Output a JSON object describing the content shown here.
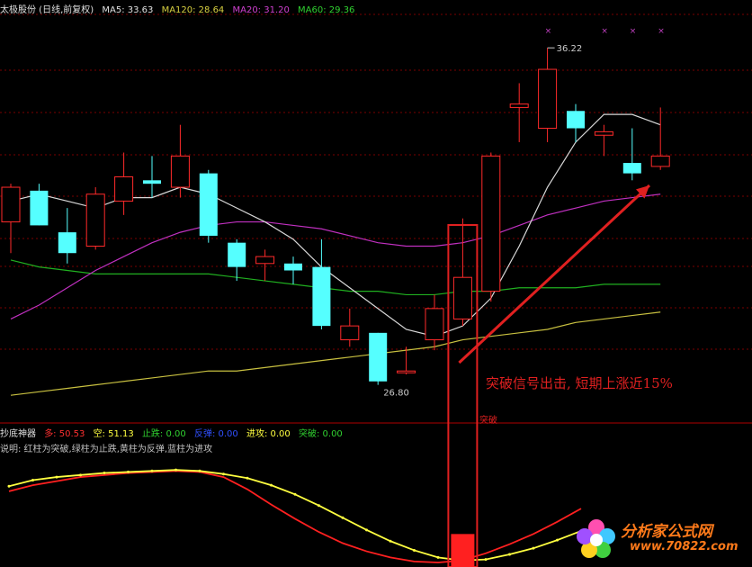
{
  "header": {
    "title": "太极股份 (日线,前复权)",
    "ma5_label": "MA5: 33.63",
    "ma120_label": "MA120: 28.64",
    "ma20_label": "MA20: 31.20",
    "ma60_label": "MA60: 29.36"
  },
  "colors": {
    "up": "#ff2a2a",
    "down": "#55ffff",
    "ma5": "#d8d8d8",
    "ma20": "#c030c0",
    "ma60": "#20b020",
    "ma120": "#c8c040",
    "grid": "#7a0000",
    "annotation": "#e02020",
    "sub_yellow": "#ffff40",
    "sub_red": "#ff2020"
  },
  "indicator": {
    "name": "抄底神器",
    "duo": "多: 50.53",
    "kong": "空: 51.13",
    "zhidie": "止跌: 0.00",
    "fantan": "反弹: 0.00",
    "jingong": "进攻: 0.00",
    "tupo": "突破: 0.00",
    "note": "说明: 红柱为突破,绿柱为止跌,黄柱为反弹,蓝柱为进攻"
  },
  "annotation": {
    "text": "突破信号出击, 短期上涨近15%",
    "signal_label": "突破"
  },
  "watermark": {
    "name": "分析家公式网",
    "url": "www.70822.com"
  },
  "chart_data": {
    "type": "candlestick",
    "price_range": [
      25.4,
      37.6
    ],
    "high_label": "36.22",
    "low_label": "26.80",
    "candles": [
      {
        "o": 31.2,
        "h": 32.3,
        "l": 30.3,
        "c": 32.2
      },
      {
        "o": 32.1,
        "h": 32.3,
        "l": 31.1,
        "c": 31.1
      },
      {
        "o": 30.9,
        "h": 31.6,
        "l": 30.0,
        "c": 30.3
      },
      {
        "o": 30.5,
        "h": 32.2,
        "l": 30.4,
        "c": 32.0
      },
      {
        "o": 31.8,
        "h": 33.2,
        "l": 31.4,
        "c": 32.5
      },
      {
        "o": 32.4,
        "h": 33.1,
        "l": 31.9,
        "c": 32.3
      },
      {
        "o": 32.2,
        "h": 34.0,
        "l": 31.9,
        "c": 33.1
      },
      {
        "o": 32.6,
        "h": 32.7,
        "l": 30.6,
        "c": 30.8
      },
      {
        "o": 30.6,
        "h": 30.7,
        "l": 29.5,
        "c": 29.9
      },
      {
        "o": 30.0,
        "h": 30.4,
        "l": 29.5,
        "c": 30.2
      },
      {
        "o": 30.0,
        "h": 30.2,
        "l": 29.4,
        "c": 29.8
      },
      {
        "o": 29.9,
        "h": 30.7,
        "l": 28.1,
        "c": 28.2
      },
      {
        "o": 27.8,
        "h": 28.7,
        "l": 27.6,
        "c": 28.2
      },
      {
        "o": 28.0,
        "h": 28.0,
        "l": 26.5,
        "c": 26.6
      },
      {
        "o": 26.9,
        "h": 27.6,
        "l": 26.8,
        "c": 26.9
      },
      {
        "o": 27.8,
        "h": 29.1,
        "l": 27.5,
        "c": 28.7
      },
      {
        "o": 28.4,
        "h": 31.3,
        "l": 28.2,
        "c": 29.6
      },
      {
        "o": 29.2,
        "h": 33.2,
        "l": 28.9,
        "c": 33.1
      },
      {
        "o": 34.5,
        "h": 35.2,
        "l": 33.5,
        "c": 34.6
      },
      {
        "o": 33.9,
        "h": 36.22,
        "l": 33.5,
        "c": 35.6
      },
      {
        "o": 34.4,
        "h": 34.6,
        "l": 33.5,
        "c": 33.9
      },
      {
        "o": 33.7,
        "h": 34.0,
        "l": 33.1,
        "c": 33.8
      },
      {
        "o": 32.9,
        "h": 33.9,
        "l": 32.4,
        "c": 32.6
      },
      {
        "o": 32.8,
        "h": 34.5,
        "l": 32.7,
        "c": 33.1
      }
    ],
    "ma5": [
      31.8,
      32.0,
      31.8,
      31.6,
      31.9,
      31.9,
      32.2,
      32.0,
      31.6,
      31.2,
      30.7,
      29.9,
      29.3,
      28.7,
      28.1,
      27.9,
      28.2,
      29.0,
      30.5,
      32.2,
      33.5,
      34.3,
      34.3,
      34.0
    ],
    "ma20": [
      28.4,
      28.8,
      29.3,
      29.8,
      30.2,
      30.6,
      30.9,
      31.1,
      31.2,
      31.2,
      31.1,
      31.0,
      30.8,
      30.6,
      30.5,
      30.5,
      30.6,
      30.8,
      31.1,
      31.4,
      31.6,
      31.8,
      31.9,
      32.0
    ],
    "ma60": [
      30.1,
      29.9,
      29.8,
      29.7,
      29.7,
      29.7,
      29.7,
      29.7,
      29.6,
      29.5,
      29.4,
      29.3,
      29.2,
      29.2,
      29.1,
      29.1,
      29.2,
      29.2,
      29.3,
      29.3,
      29.3,
      29.4,
      29.4,
      29.4
    ],
    "ma120": [
      26.2,
      26.3,
      26.4,
      26.5,
      26.6,
      26.7,
      26.8,
      26.9,
      26.9,
      27.0,
      27.1,
      27.2,
      27.3,
      27.4,
      27.5,
      27.6,
      27.8,
      27.9,
      28.0,
      28.1,
      28.3,
      28.4,
      28.5,
      28.6
    ],
    "sub_range": [
      0,
      100
    ],
    "sub_yellow": [
      75,
      81,
      84,
      86,
      88,
      89,
      90,
      91,
      90,
      87,
      83,
      76,
      67,
      56,
      44,
      32,
      21,
      12,
      5,
      2,
      3,
      8,
      14,
      22,
      31
    ],
    "sub_red": [
      70,
      76,
      80,
      84,
      86,
      88,
      89,
      90,
      89,
      84,
      72,
      57,
      43,
      30,
      19,
      11,
      5,
      1,
      0,
      2,
      9,
      18,
      28,
      40,
      53
    ],
    "signal_index": 16,
    "signal_bar_value": 28
  }
}
